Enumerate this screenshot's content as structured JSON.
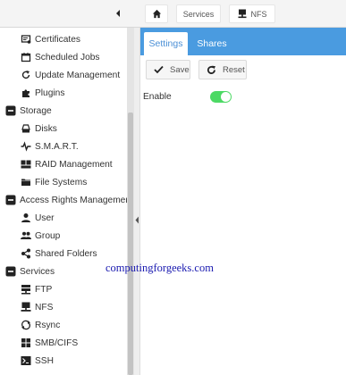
{
  "breadcrumb": {
    "services_label": "Services",
    "nfs_label": "NFS"
  },
  "sidebar": {
    "items": [
      {
        "label": "Certificates",
        "icon": "certificate-icon",
        "type": "item"
      },
      {
        "label": "Scheduled Jobs",
        "icon": "calendar-icon",
        "type": "item"
      },
      {
        "label": "Update Management",
        "icon": "refresh-icon",
        "type": "item"
      },
      {
        "label": "Plugins",
        "icon": "puzzle-icon",
        "type": "item"
      },
      {
        "label": "Storage",
        "icon": "collapse-minus-icon",
        "type": "group"
      },
      {
        "label": "Disks",
        "icon": "disk-icon",
        "type": "item"
      },
      {
        "label": "S.M.A.R.T.",
        "icon": "heartbeat-icon",
        "type": "item"
      },
      {
        "label": "RAID Management",
        "icon": "raid-icon",
        "type": "item"
      },
      {
        "label": "File Systems",
        "icon": "folder-icon",
        "type": "item"
      },
      {
        "label": "Access Rights Management",
        "icon": "collapse-minus-icon",
        "type": "group"
      },
      {
        "label": "User",
        "icon": "user-icon",
        "type": "item"
      },
      {
        "label": "Group",
        "icon": "group-icon",
        "type": "item"
      },
      {
        "label": "Shared Folders",
        "icon": "share-icon",
        "type": "item"
      },
      {
        "label": "Services",
        "icon": "collapse-minus-icon",
        "type": "group"
      },
      {
        "label": "FTP",
        "icon": "server-icon",
        "type": "item"
      },
      {
        "label": "NFS",
        "icon": "nfs-icon",
        "type": "item"
      },
      {
        "label": "Rsync",
        "icon": "rsync-icon",
        "type": "item"
      },
      {
        "label": "SMB/CIFS",
        "icon": "windows-icon",
        "type": "item"
      },
      {
        "label": "SSH",
        "icon": "terminal-icon",
        "type": "item"
      }
    ]
  },
  "main": {
    "tabs": [
      {
        "label": "Settings",
        "active": true
      },
      {
        "label": "Shares",
        "active": false
      }
    ],
    "toolbar": {
      "save_label": "Save",
      "reset_label": "Reset"
    },
    "form": {
      "enable_label": "Enable",
      "enable_value": true
    }
  },
  "watermark": "computingforgeeks.com",
  "colors": {
    "tab_bar": "#4a9be0",
    "toggle_on": "#4cd964",
    "watermark": "#1a1ab0"
  }
}
